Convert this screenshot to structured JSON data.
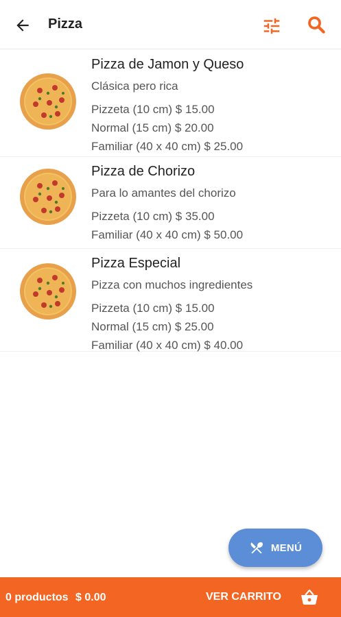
{
  "header": {
    "title": "Pizza",
    "back_icon": "arrow-left-icon",
    "filter_icon": "tune-sliders-icon",
    "search_icon": "search-icon",
    "accent_color": "#f26522"
  },
  "items": [
    {
      "name": "Pizza de Jamon y Queso",
      "description": "Clásica pero rica",
      "prices": [
        "Pizzeta (10 cm) $ 15.00",
        "Normal (15 cm) $ 20.00",
        "Familiar (40 x 40 cm) $ 25.00"
      ]
    },
    {
      "name": "Pizza de Chorizo",
      "description": "Para lo amantes del chorizo",
      "prices": [
        "Pizzeta (10 cm) $ 35.00",
        "Familiar (40 x 40 cm) $ 50.00"
      ]
    },
    {
      "name": "Pizza Especial",
      "description": "Pizza con muchos ingredientes",
      "prices": [
        "Pizzeta (10 cm) $ 15.00",
        "Normal (15 cm) $ 25.00",
        "Familiar (40 x 40 cm) $ 40.00"
      ]
    }
  ],
  "fab": {
    "label": "MENÚ",
    "icon": "fork-knife-icon",
    "color": "#5b8ed6"
  },
  "cart": {
    "count_text": "0 productos",
    "total_text": "$ 0.00",
    "button_label": "VER CARRITO",
    "icon": "basket-icon",
    "bar_color": "#f26522"
  }
}
